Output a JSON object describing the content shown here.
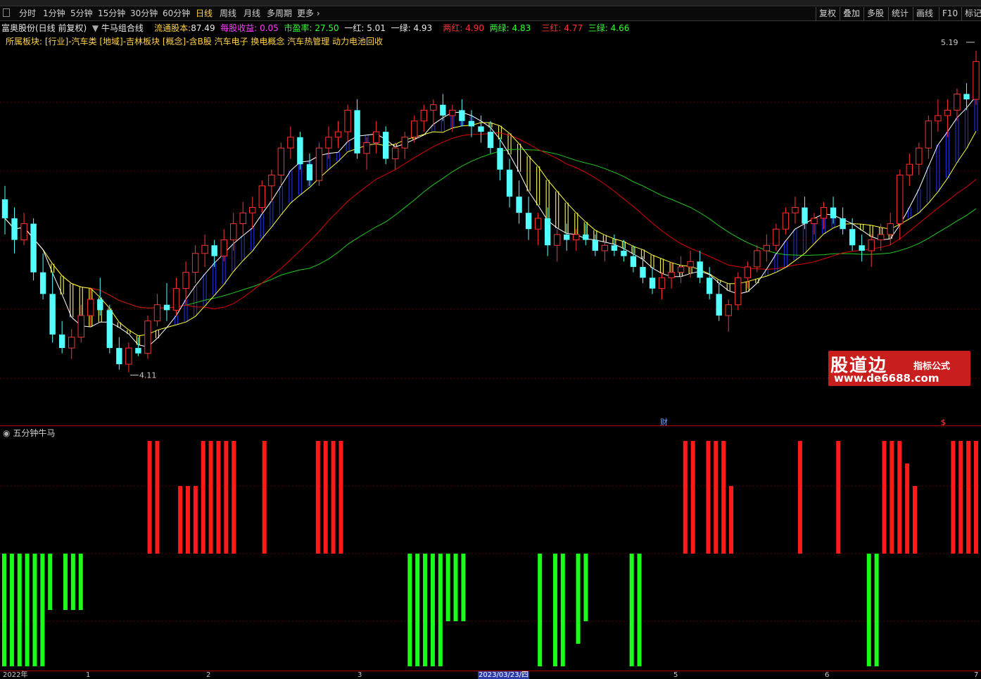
{
  "toolbar": {
    "periods": [
      "分时",
      "1分钟",
      "5分钟",
      "15分钟",
      "30分钟",
      "60分钟",
      "日线",
      "周线",
      "月线",
      "多周期",
      "更多"
    ],
    "active_period": "日线",
    "right_buttons": [
      "复权",
      "叠加",
      "多股",
      "统计",
      "画线",
      "F10",
      "标记"
    ]
  },
  "info": {
    "stock_name": "富奥股份(日线 前复权)",
    "indicator_name": "牛马组合线",
    "float_shares_label": "流通股本:",
    "float_shares": "87.49",
    "eps_label": "每股收益:",
    "eps": "0.05",
    "pe_label": "市盈率:",
    "pe": "27.50",
    "one_red_label": "一红:",
    "one_red": "5.01",
    "one_green_label": "一绿:",
    "one_green": "4.93",
    "two_red_label": "两红:",
    "two_red": "4.90",
    "two_green_label": "两绿:",
    "two_green": "4.83",
    "three_red_label": "三红:",
    "three_red": "4.77",
    "three_green_label": "三绿:",
    "three_green": "4.66"
  },
  "sector_line": "所属板块: [行业]-汽车类 [地域]-吉林板块 [概念]-含B股 汽车电子 换电概念 汽车热管理 动力电池回收",
  "price_labels": {
    "high": "5.19",
    "low": "4.11"
  },
  "event_markers": {
    "finance": "财",
    "dollar": "$"
  },
  "indicator_panel": {
    "title": "五分钟牛马"
  },
  "x_axis": {
    "labels": [
      "2022年",
      "1",
      "2",
      "3",
      "5",
      "6",
      "7"
    ],
    "cursor_date": "2023/03/23/四"
  },
  "watermark": {
    "title": "股道边",
    "subtitle": "指标公式",
    "url": "www.de6688.com"
  },
  "colors": {
    "up": "#ff3232",
    "down": "#54ffff",
    "ma_white": "#ffffff",
    "ma_yellow": "#ffff3c",
    "ma_red": "#e00000",
    "ma_green": "#22c822",
    "ribbon_yellow": "#e6e650",
    "ribbon_blue": "#1e2ccc",
    "signal_red": "#ff1a1a",
    "signal_green": "#1aff1a",
    "grid": "#5a0000"
  },
  "chart_data": {
    "type": "candlestick",
    "note_y_range": [
      3.95,
      5.3
    ],
    "candles": [
      [
        4.75,
        4.8,
        4.62,
        4.68
      ],
      [
        4.68,
        4.72,
        4.55,
        4.6
      ],
      [
        4.6,
        4.7,
        4.58,
        4.66
      ],
      [
        4.66,
        4.68,
        4.45,
        4.48
      ],
      [
        4.48,
        4.55,
        4.38,
        4.4
      ],
      [
        4.4,
        4.48,
        4.22,
        4.25
      ],
      [
        4.25,
        4.3,
        4.18,
        4.2
      ],
      [
        4.2,
        4.27,
        4.16,
        4.24
      ],
      [
        4.24,
        4.36,
        4.22,
        4.32
      ],
      [
        4.32,
        4.42,
        4.28,
        4.38
      ],
      [
        4.38,
        4.46,
        4.32,
        4.34
      ],
      [
        4.34,
        4.36,
        4.18,
        4.2
      ],
      [
        4.2,
        4.24,
        4.12,
        4.14
      ],
      [
        4.14,
        4.22,
        4.11,
        4.2
      ],
      [
        4.2,
        4.24,
        4.17,
        4.18
      ],
      [
        4.18,
        4.32,
        4.16,
        4.3
      ],
      [
        4.3,
        4.4,
        4.28,
        4.36
      ],
      [
        4.36,
        4.44,
        4.3,
        4.34
      ],
      [
        4.34,
        4.46,
        4.32,
        4.42
      ],
      [
        4.42,
        4.52,
        4.36,
        4.48
      ],
      [
        4.48,
        4.58,
        4.44,
        4.55
      ],
      [
        4.55,
        4.62,
        4.5,
        4.58
      ],
      [
        4.58,
        4.6,
        4.5,
        4.54
      ],
      [
        4.54,
        4.64,
        4.52,
        4.6
      ],
      [
        4.6,
        4.7,
        4.56,
        4.66
      ],
      [
        4.66,
        4.74,
        4.62,
        4.7
      ],
      [
        4.7,
        4.76,
        4.64,
        4.72
      ],
      [
        4.72,
        4.82,
        4.7,
        4.8
      ],
      [
        4.8,
        4.86,
        4.74,
        4.84
      ],
      [
        4.84,
        4.96,
        4.8,
        4.94
      ],
      [
        4.94,
        5.02,
        4.9,
        4.98
      ],
      [
        4.98,
        5.0,
        4.86,
        4.88
      ],
      [
        4.88,
        4.92,
        4.8,
        4.82
      ],
      [
        4.82,
        4.96,
        4.8,
        4.94
      ],
      [
        4.94,
        5.02,
        4.9,
        4.98
      ],
      [
        4.98,
        5.04,
        4.94,
        5.0
      ],
      [
        5.0,
        5.1,
        4.96,
        5.08
      ],
      [
        5.08,
        5.12,
        4.9,
        4.92
      ],
      [
        4.92,
        4.98,
        4.86,
        4.96
      ],
      [
        4.96,
        5.04,
        4.92,
        5.0
      ],
      [
        5.0,
        5.02,
        4.88,
        4.9
      ],
      [
        4.9,
        4.96,
        4.86,
        4.94
      ],
      [
        4.94,
        5.0,
        4.9,
        4.98
      ],
      [
        4.98,
        5.06,
        4.96,
        5.04
      ],
      [
        5.04,
        5.1,
        5.0,
        5.08
      ],
      [
        5.08,
        5.12,
        5.02,
        5.1
      ],
      [
        5.1,
        5.14,
        5.04,
        5.06
      ],
      [
        5.06,
        5.1,
        5.0,
        5.08
      ],
      [
        5.08,
        5.12,
        5.02,
        5.04
      ],
      [
        5.04,
        5.08,
        4.98,
        5.02
      ],
      [
        5.02,
        5.06,
        4.96,
        5.0
      ],
      [
        5.0,
        5.04,
        4.92,
        4.94
      ],
      [
        4.94,
        4.98,
        4.82,
        4.86
      ],
      [
        4.86,
        4.9,
        4.72,
        4.76
      ],
      [
        4.76,
        4.82,
        4.66,
        4.7
      ],
      [
        4.7,
        4.76,
        4.6,
        4.64
      ],
      [
        4.64,
        4.7,
        4.58,
        4.68
      ],
      [
        4.68,
        4.72,
        4.54,
        4.58
      ],
      [
        4.58,
        4.64,
        4.52,
        4.62
      ],
      [
        4.62,
        4.66,
        4.56,
        4.6
      ],
      [
        4.6,
        4.64,
        4.56,
        4.62
      ],
      [
        4.62,
        4.66,
        4.58,
        4.6
      ],
      [
        4.6,
        4.62,
        4.54,
        4.56
      ],
      [
        4.56,
        4.6,
        4.52,
        4.58
      ],
      [
        4.58,
        4.62,
        4.54,
        4.56
      ],
      [
        4.56,
        4.6,
        4.52,
        4.54
      ],
      [
        4.54,
        4.58,
        4.48,
        4.5
      ],
      [
        4.5,
        4.54,
        4.44,
        4.46
      ],
      [
        4.46,
        4.5,
        4.4,
        4.42
      ],
      [
        4.42,
        4.48,
        4.38,
        4.46
      ],
      [
        4.46,
        4.52,
        4.42,
        4.48
      ],
      [
        4.48,
        4.54,
        4.44,
        4.5
      ],
      [
        4.5,
        4.56,
        4.46,
        4.52
      ],
      [
        4.52,
        4.56,
        4.44,
        4.46
      ],
      [
        4.46,
        4.5,
        4.38,
        4.4
      ],
      [
        4.4,
        4.44,
        4.3,
        4.32
      ],
      [
        4.32,
        4.38,
        4.26,
        4.36
      ],
      [
        4.36,
        4.48,
        4.34,
        4.46
      ],
      [
        4.46,
        4.52,
        4.42,
        4.5
      ],
      [
        4.5,
        4.58,
        4.48,
        4.56
      ],
      [
        4.56,
        4.62,
        4.52,
        4.58
      ],
      [
        4.58,
        4.66,
        4.56,
        4.64
      ],
      [
        4.64,
        4.72,
        4.62,
        4.7
      ],
      [
        4.7,
        4.76,
        4.66,
        4.72
      ],
      [
        4.72,
        4.76,
        4.64,
        4.66
      ],
      [
        4.66,
        4.7,
        4.62,
        4.68
      ],
      [
        4.68,
        4.74,
        4.64,
        4.72
      ],
      [
        4.72,
        4.76,
        4.66,
        4.68
      ],
      [
        4.68,
        4.72,
        4.62,
        4.64
      ],
      [
        4.64,
        4.68,
        4.56,
        4.58
      ],
      [
        4.58,
        4.62,
        4.52,
        4.56
      ],
      [
        4.56,
        4.62,
        4.5,
        4.6
      ],
      [
        4.6,
        4.66,
        4.56,
        4.62
      ],
      [
        4.62,
        4.7,
        4.58,
        4.66
      ],
      [
        4.66,
        4.86,
        4.6,
        4.84
      ],
      [
        4.84,
        4.92,
        4.8,
        4.88
      ],
      [
        4.88,
        4.96,
        4.84,
        4.94
      ],
      [
        4.94,
        5.06,
        4.9,
        5.04
      ],
      [
        5.04,
        5.12,
        5.0,
        5.06
      ],
      [
        5.06,
        5.12,
        4.98,
        5.08
      ],
      [
        5.08,
        5.16,
        5.04,
        5.14
      ],
      [
        5.14,
        5.18,
        5.08,
        5.12
      ],
      [
        5.12,
        5.3,
        5.1,
        5.26
      ]
    ],
    "signals": [
      -1,
      -1,
      -1,
      -1,
      -1,
      -1,
      -0.5,
      0,
      -0.5,
      -0.5,
      -0.5,
      0,
      0,
      0,
      0,
      0,
      0,
      0,
      0,
      1,
      1,
      0,
      0,
      0.6,
      0.6,
      0.6,
      1,
      1,
      1,
      1,
      1,
      0,
      0,
      0,
      1,
      0,
      0,
      0,
      0,
      0,
      0,
      1,
      1,
      1,
      1,
      0,
      0,
      0,
      0,
      0,
      0,
      0,
      0,
      -1,
      -1,
      -1,
      -1,
      -1,
      -0.6,
      -0.6,
      -0.6,
      0,
      0,
      0,
      0,
      0,
      0,
      0,
      0,
      0,
      -1,
      0,
      -1,
      -1,
      0,
      -0.8,
      -0.6,
      0,
      0,
      0,
      0,
      0,
      -1,
      -1,
      0,
      0,
      0,
      0,
      0,
      1,
      1,
      0,
      1,
      1,
      1,
      0.6,
      0,
      0,
      0,
      0,
      0,
      0,
      0,
      0,
      1,
      0,
      0,
      0,
      0,
      1,
      0,
      0,
      0,
      -1,
      -1,
      1,
      1,
      1,
      0.8,
      0.6,
      0,
      0,
      0,
      0,
      1,
      1,
      1,
      1
    ]
  }
}
